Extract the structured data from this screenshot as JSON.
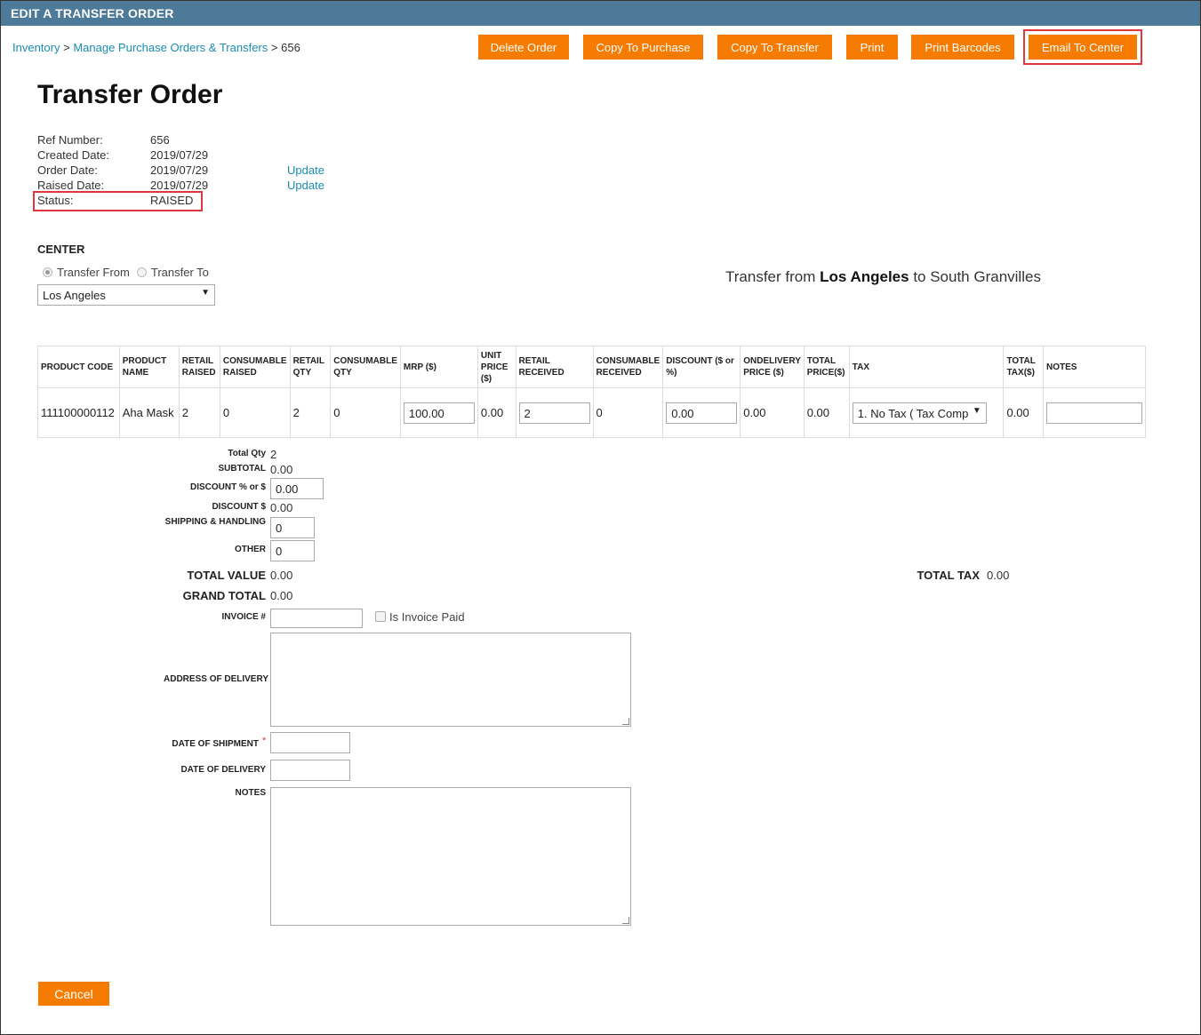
{
  "header": {
    "title": "EDIT A TRANSFER ORDER"
  },
  "breadcrumb": {
    "items": [
      "Inventory",
      "Manage Purchase Orders & Transfers"
    ],
    "separator": ">",
    "current": "656"
  },
  "toolbar": {
    "delete_label": "Delete Order",
    "copy_purchase_label": "Copy To Purchase",
    "copy_transfer_label": "Copy To Transfer",
    "print_label": "Print",
    "print_barcodes_label": "Print Barcodes",
    "email_label": "Email To Center"
  },
  "page_title": "Transfer Order",
  "order_info": {
    "ref_label": "Ref Number:",
    "ref_value": "656",
    "created_label": "Created Date:",
    "created_value": "2019/07/29",
    "order_label": "Order Date:",
    "order_value": "2019/07/29",
    "raised_label": "Raised Date:",
    "raised_value": "2019/07/29",
    "status_label": "Status:",
    "status_value": "RAISED",
    "update_label": "Update"
  },
  "center": {
    "title": "CENTER",
    "radio_from": "Transfer From",
    "radio_to": "Transfer To",
    "selected_center": "Los Angeles",
    "heading_prefix": "Transfer from",
    "heading_from": "Los Angeles",
    "heading_middle": "to South Granvilles"
  },
  "table": {
    "headers": {
      "product_code": "PRODUCT CODE",
      "product_name": "PRODUCT NAME",
      "retail_raised": "RETAIL RAISED",
      "consumable_raised": "CONSUMABLE RAISED",
      "retail_qty": "RETAIL QTY",
      "consumable_qty": "CONSUMABLE QTY",
      "mrp": "MRP ($)",
      "unit_price": "UNIT PRICE ($)",
      "retail_received": "RETAIL RECEIVED",
      "consumable_received": "CONSUMABLE RECEIVED",
      "discount": "DISCOUNT ($ or %)",
      "ondelivery_price": "ONDELIVERY PRICE ($)",
      "total_price": "TOTAL PRICE($)",
      "tax": "TAX",
      "total_tax": "TOTAL TAX($)",
      "notes": "NOTES"
    },
    "row": {
      "product_code": "111100000112",
      "product_name": "Aha Mask",
      "retail_raised": "2",
      "consumable_raised": "0",
      "retail_qty": "2",
      "consumable_qty": "0",
      "mrp": "100.00",
      "unit_price": "0.00",
      "retail_received": "2",
      "consumable_received": "0",
      "discount": "0.00",
      "ondelivery_price": "0.00",
      "total_price": "0.00",
      "tax": "1. No Tax ( Tax Comp",
      "total_tax": "0.00",
      "notes": ""
    }
  },
  "totals": {
    "total_qty_label": "Total Qty",
    "total_qty": "2",
    "subtotal_label": "SUBTOTAL",
    "subtotal": "0.00",
    "discount_pct_label": "DISCOUNT % or $",
    "discount_pct": "0.00",
    "discount_label": "DISCOUNT $",
    "discount": "0.00",
    "shipping_label": "SHIPPING & HANDLING",
    "shipping": "0",
    "other_label": "OTHER",
    "other": "0",
    "total_value_label": "TOTAL VALUE",
    "total_value": "0.00",
    "total_tax_label": "TOTAL TAX",
    "total_tax": "0.00",
    "grand_total_label": "GRAND TOTAL",
    "grand_total": "0.00"
  },
  "form": {
    "invoice_label": "INVOICE #",
    "invoice_value": "",
    "invoice_paid_label": "Is Invoice Paid",
    "address_label": "ADDRESS OF DELIVERY",
    "shipment_label": "DATE OF SHIPMENT",
    "required_mark": "*",
    "delivery_label": "DATE OF DELIVERY",
    "notes_label": "NOTES"
  },
  "footer": {
    "cancel_label": "Cancel"
  },
  "colors": {
    "accent": "#f57c00",
    "header_bg": "#4d7a99",
    "link": "#1a8bb3",
    "highlight": "#e0363f"
  }
}
